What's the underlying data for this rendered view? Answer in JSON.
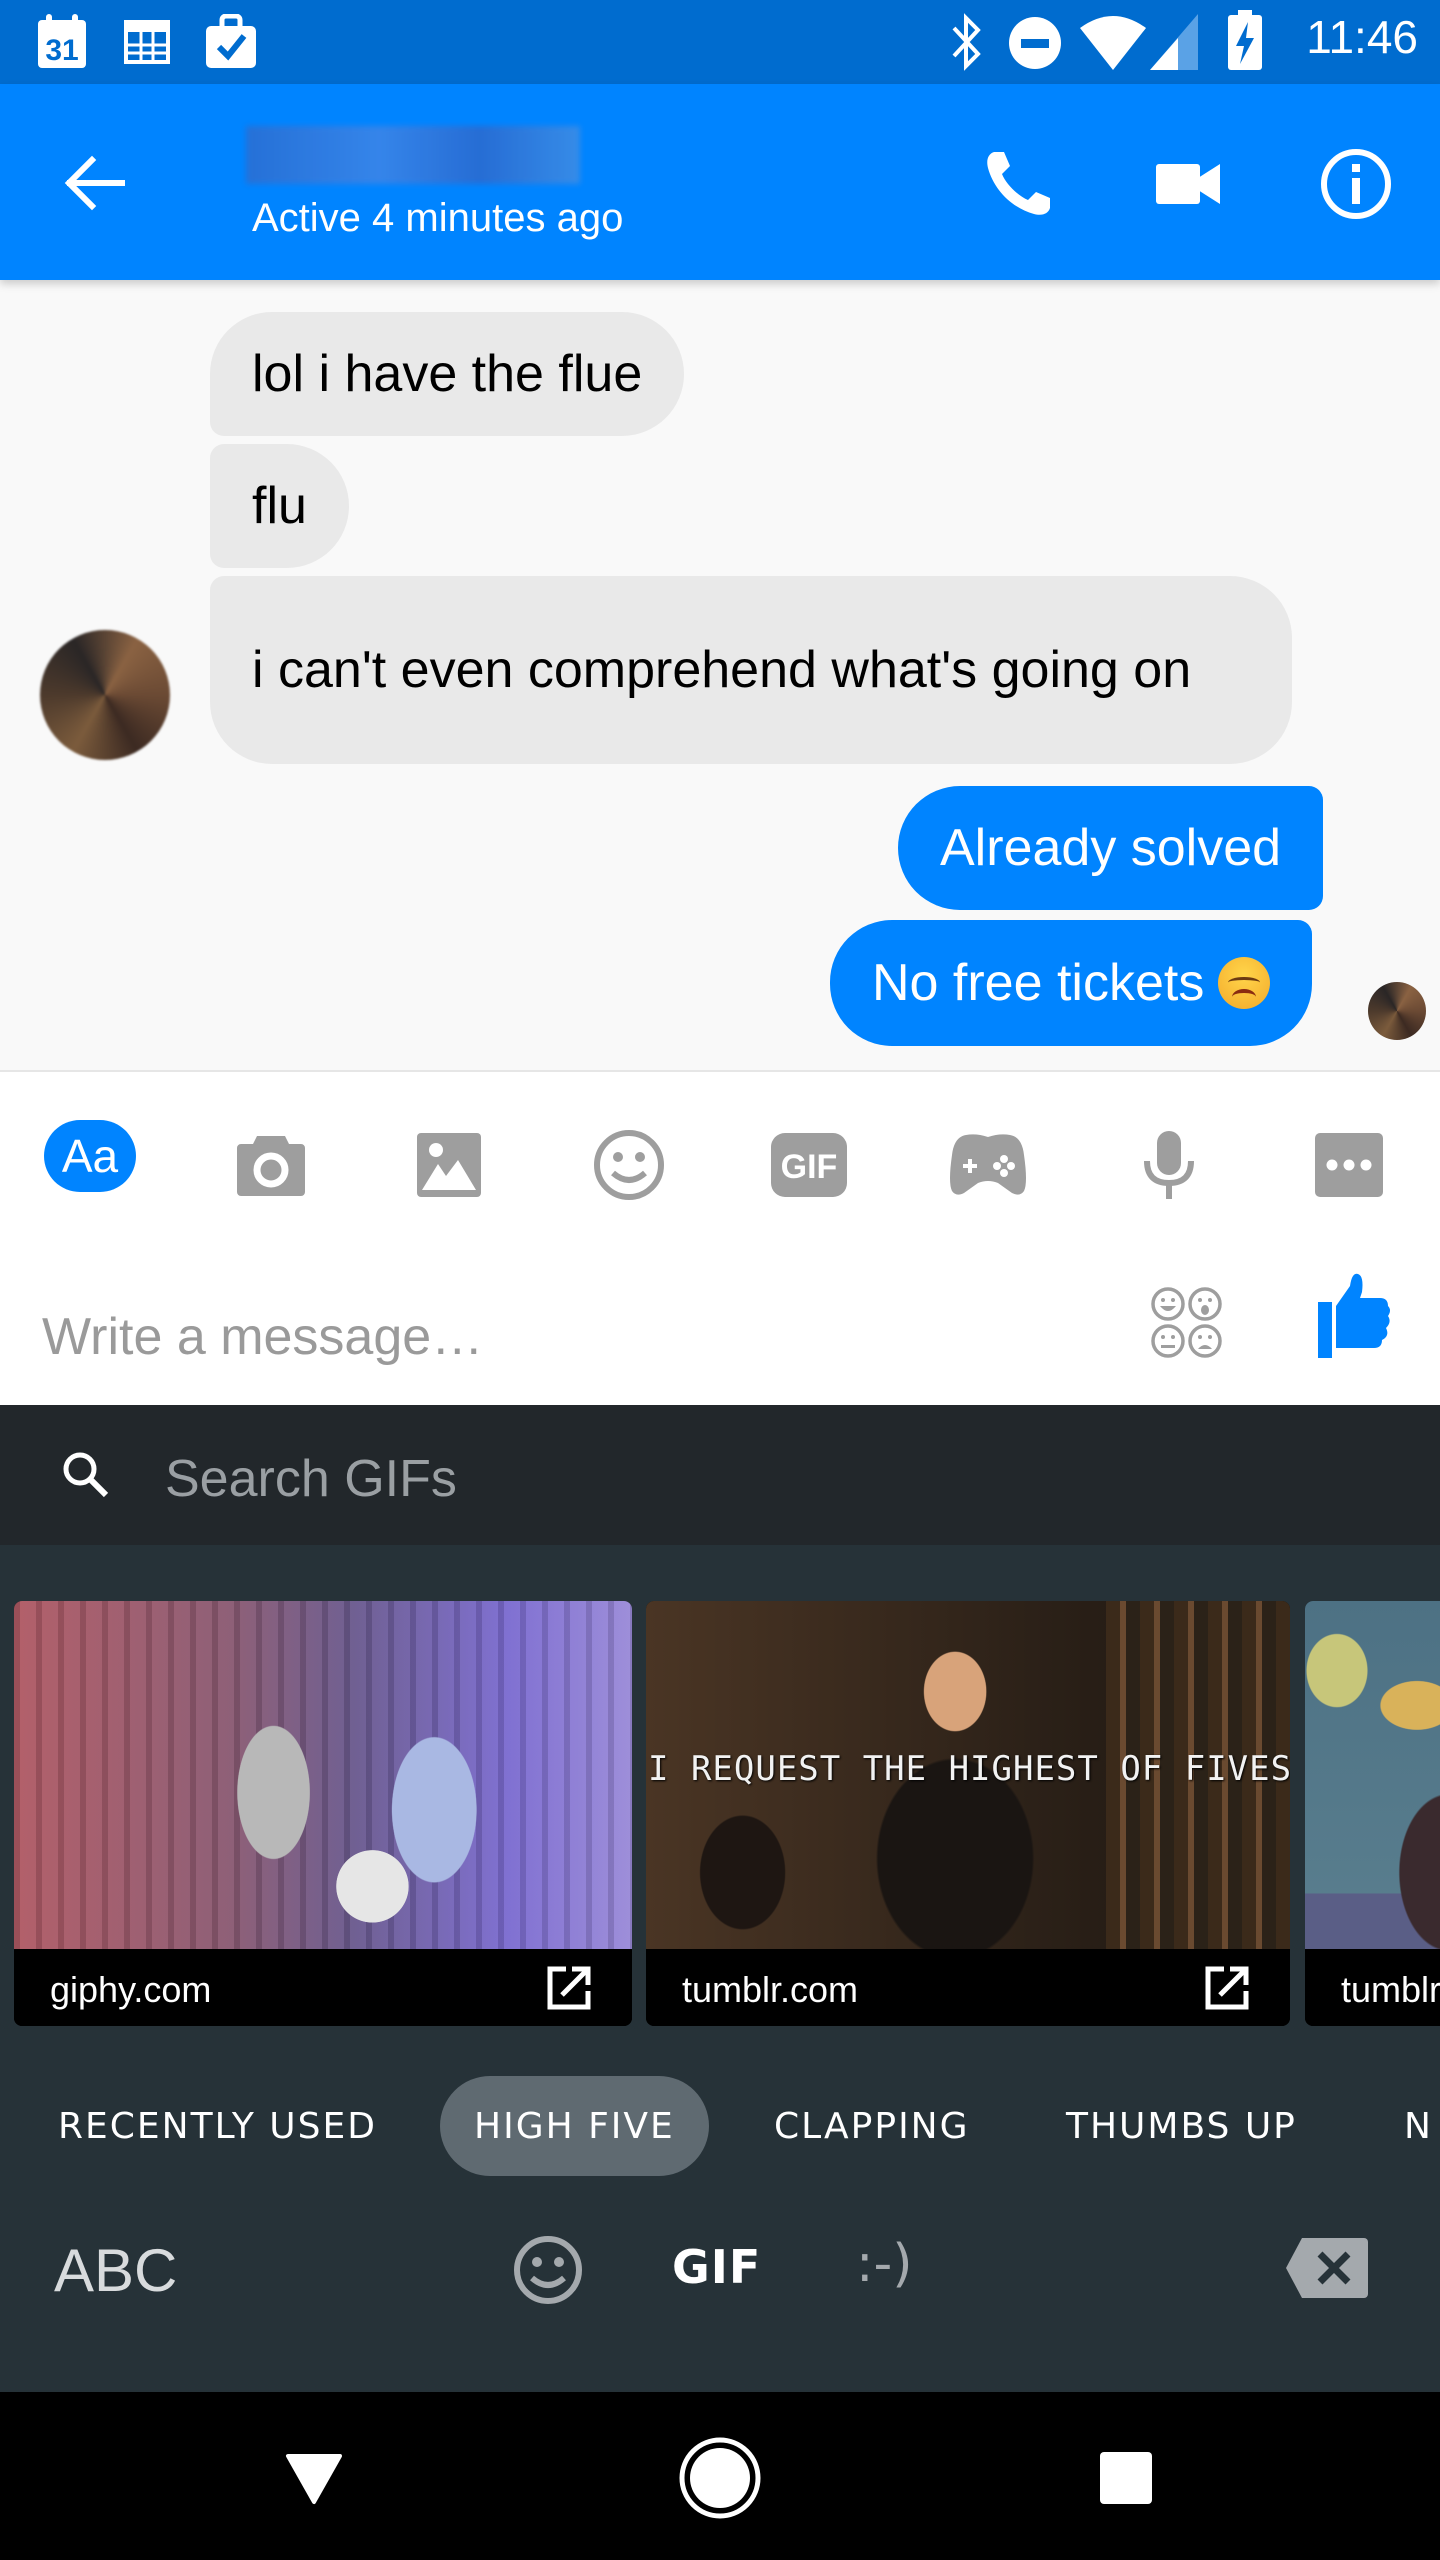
{
  "status_bar": {
    "left_icons": [
      "calendar-31-icon",
      "calendar-grid-icon",
      "briefcase-check-icon"
    ],
    "calendar_day": "31",
    "right_icons": [
      "bluetooth-icon",
      "do-not-disturb-icon",
      "wifi-icon",
      "cell-signal-icon",
      "battery-charging-icon"
    ],
    "time": "11:46"
  },
  "header": {
    "contact_name": "",
    "presence": "Active 4 minutes ago",
    "actions": [
      "phone-icon",
      "video-camera-icon",
      "info-icon"
    ]
  },
  "messages": [
    {
      "direction": "incoming",
      "text": "lol i have the flue"
    },
    {
      "direction": "incoming",
      "text": "flu"
    },
    {
      "direction": "incoming",
      "text": "i can't even comprehend what's going on"
    },
    {
      "direction": "outgoing",
      "text": "Already solved"
    },
    {
      "direction": "outgoing",
      "text": "No free tickets",
      "emoji": "disappointed-face"
    }
  ],
  "composer": {
    "tools": [
      {
        "name": "text",
        "label": "Aa",
        "active": true
      },
      {
        "name": "camera"
      },
      {
        "name": "gallery"
      },
      {
        "name": "emoji"
      },
      {
        "name": "gif",
        "label": "GIF"
      },
      {
        "name": "games"
      },
      {
        "name": "microphone"
      },
      {
        "name": "more"
      }
    ],
    "placeholder": "Write a message…",
    "value": ""
  },
  "gif_keyboard": {
    "search_placeholder": "Search GIFs",
    "results": [
      {
        "source": "giphy.com",
        "caption": ""
      },
      {
        "source": "tumblr.com",
        "caption": "I REQUEST THE HIGHEST OF FIVES"
      },
      {
        "source": "tumblr.com",
        "caption": ""
      }
    ],
    "categories": [
      {
        "label": "RECENTLY USED",
        "active": false
      },
      {
        "label": "HIGH FIVE",
        "active": true
      },
      {
        "label": "CLAPPING",
        "active": false
      },
      {
        "label": "THUMBS UP",
        "active": false
      },
      {
        "label": "N",
        "active": false
      }
    ],
    "bottom_row": {
      "abc_label": "ABC",
      "gif_label": "GIF",
      "emoticon_label": ":-)"
    }
  },
  "colors": {
    "messenger_blue": "#0084ff",
    "status_bar": "#006ccf",
    "incoming_bubble": "#e9e9e9",
    "keyboard_bg": "#263238",
    "search_bg": "#22272b",
    "active_chip": "#5f6a71",
    "icon_gray": "#9e9e9e"
  }
}
